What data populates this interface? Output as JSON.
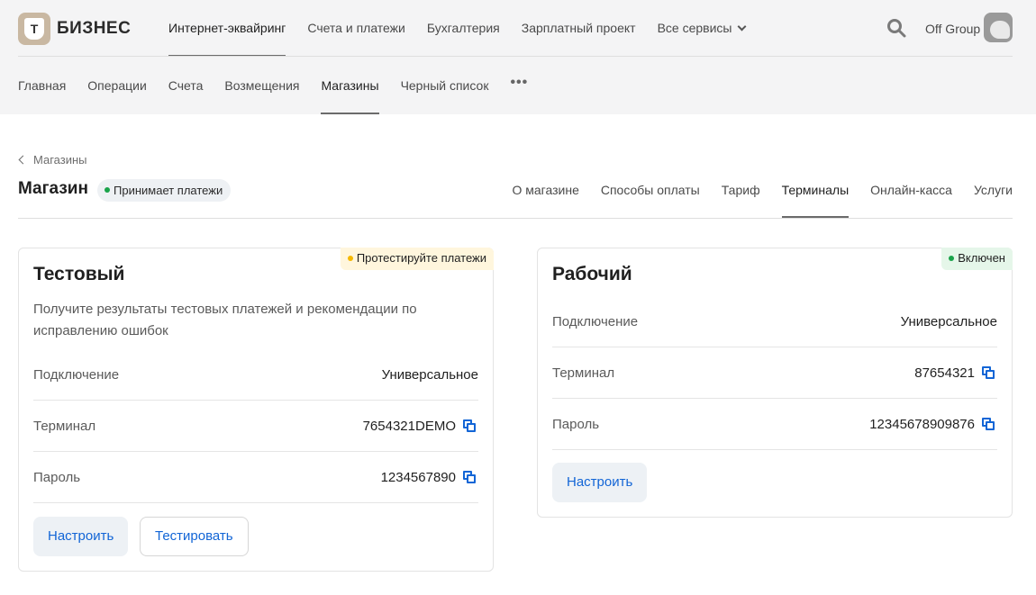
{
  "brand": {
    "logo_letter": "T",
    "name": "БИЗНЕС"
  },
  "main_nav": [
    {
      "label": "Интернет-эквайринг",
      "active": true
    },
    {
      "label": "Счета и платежи",
      "active": false
    },
    {
      "label": "Бухгалтерия",
      "active": false
    },
    {
      "label": "Зарплатный проект",
      "active": false
    },
    {
      "label": "Все сервисы",
      "active": false,
      "dropdown": true
    }
  ],
  "header": {
    "org_name": "Off Group"
  },
  "sub_nav": [
    {
      "label": "Главная",
      "active": false
    },
    {
      "label": "Операции",
      "active": false
    },
    {
      "label": "Счета",
      "active": false
    },
    {
      "label": "Возмещения",
      "active": false
    },
    {
      "label": "Магазины",
      "active": true
    },
    {
      "label": "Черный список",
      "active": false
    }
  ],
  "sub_nav_more": "•••",
  "breadcrumb": {
    "back_label": "Магазины"
  },
  "page": {
    "title": "Магазин",
    "status": "Принимает платежи"
  },
  "tabs": [
    {
      "label": "О магазине",
      "active": false
    },
    {
      "label": "Способы оплаты",
      "active": false
    },
    {
      "label": "Тариф",
      "active": false
    },
    {
      "label": "Терминалы",
      "active": true
    },
    {
      "label": "Онлайн-касса",
      "active": false
    },
    {
      "label": "Услуги",
      "active": false
    }
  ],
  "test_card": {
    "title": "Тестовый",
    "badge": "Протестируйте платежи",
    "description": "Получите результаты тестовых платежей и рекомендации по исправлению ошибок",
    "rows": [
      {
        "label": "Подключение",
        "value": "Универсальное"
      },
      {
        "label": "Терминал",
        "value": "7654321DEMO"
      },
      {
        "label": "Пароль",
        "value": "1234567890"
      }
    ],
    "configure_label": "Настроить",
    "test_label": "Тестировать"
  },
  "prod_card": {
    "title": "Рабочий",
    "badge": "Включен",
    "rows": [
      {
        "label": "Подключение",
        "value": "Универсальное"
      },
      {
        "label": "Терминал",
        "value": "87654321"
      },
      {
        "label": "Пароль",
        "value": "12345678909876"
      }
    ],
    "configure_label": "Настроить"
  },
  "colors": {
    "accent": "#1265d6",
    "status_green": "#1aa34a",
    "status_yellow": "#f5b800",
    "topbar_bg": "#f4f4f5"
  }
}
